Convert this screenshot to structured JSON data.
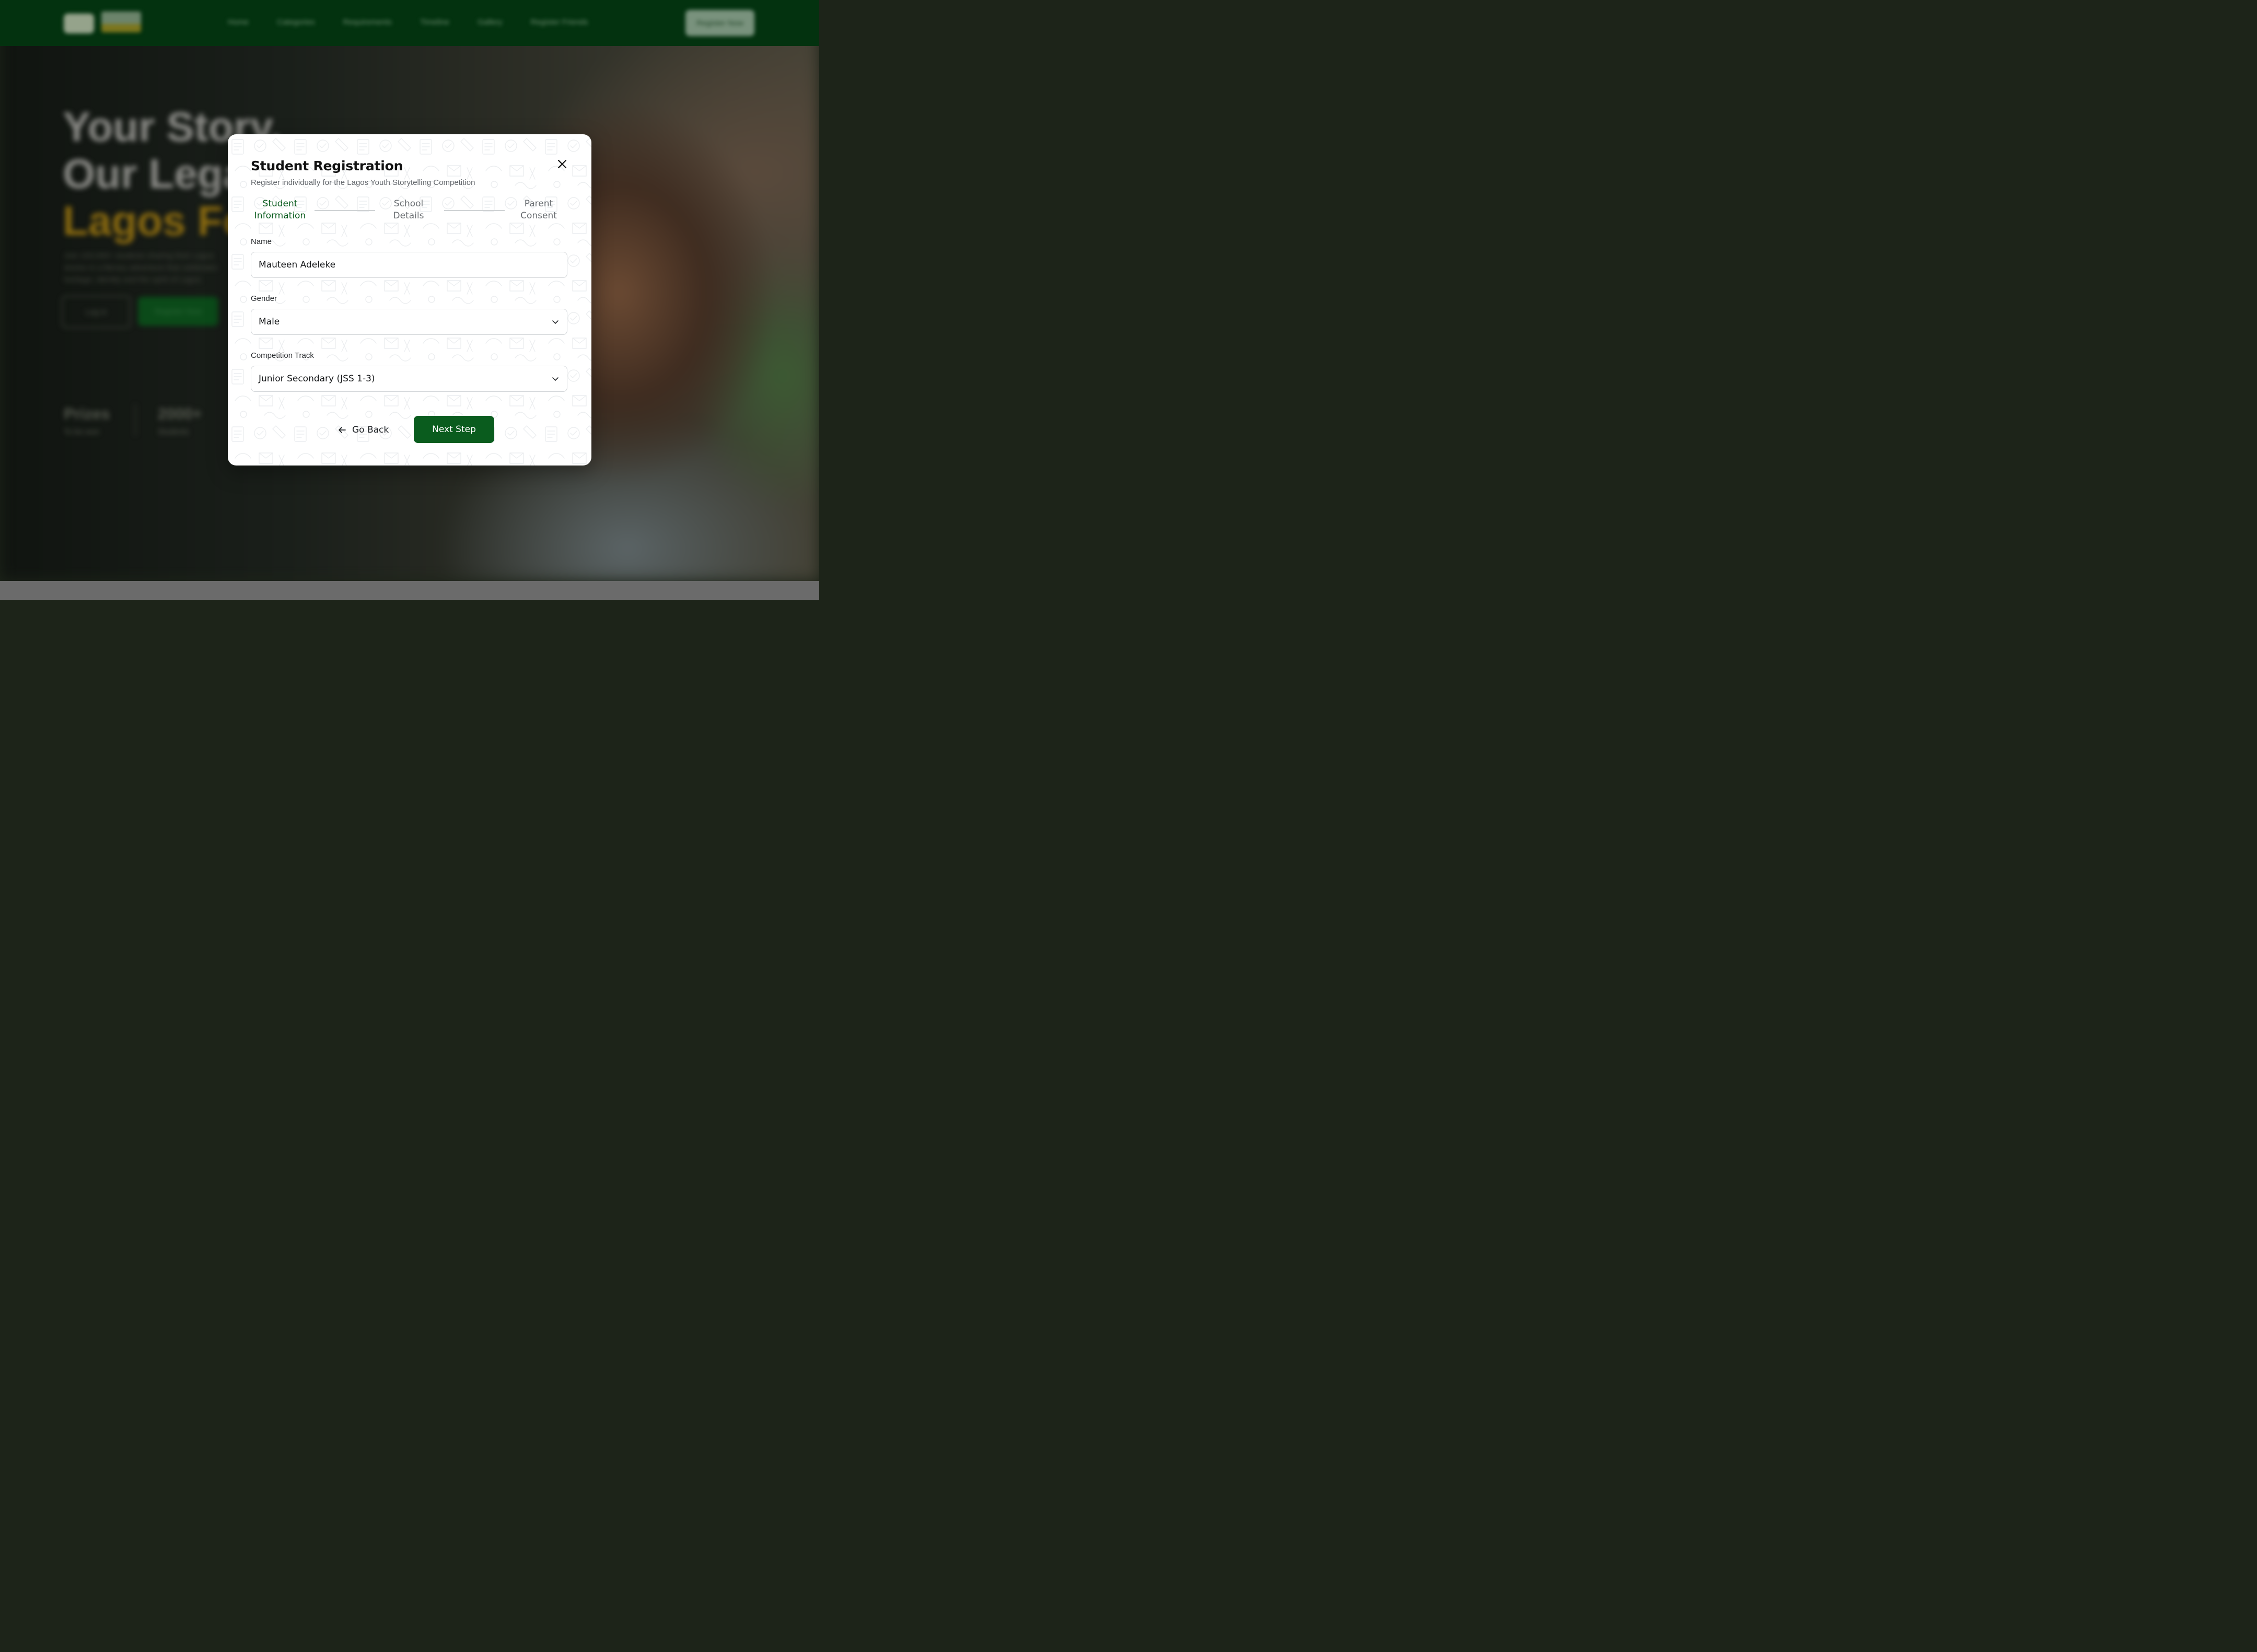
{
  "background": {
    "nav": {
      "links": [
        "Home",
        "Categories",
        "Requirements",
        "Timeline",
        "Gallery",
        "Register Friends"
      ],
      "cta_label": "Register Now"
    },
    "hero": {
      "headline_line1": "Your Story,",
      "headline_line2": "Our Legacy",
      "headline_line3": "Lagos Fo",
      "paragraph": "Join 100,000+ students sharing their Lagos stories in a literary adventure that celebrates heritage, identity and the spirit of Lagos.",
      "primary_button": "Register Now",
      "secondary_button": "Log in"
    },
    "stats": [
      {
        "value": "Prizes",
        "label": "To be won"
      },
      {
        "value": "2000+",
        "label": "Students"
      }
    ]
  },
  "modal": {
    "title": "Student Registration",
    "subtitle": "Register individually for the Lagos Youth Storytelling Competition",
    "close_icon": "close-icon",
    "steps": [
      {
        "line1": "Student",
        "line2": "Information",
        "active": true
      },
      {
        "line1": "School",
        "line2": "Details",
        "active": false
      },
      {
        "line1": "Parent",
        "line2": "Consent",
        "active": false
      }
    ],
    "fields": {
      "name": {
        "label": "Name",
        "value": "Mauteen Adeleke"
      },
      "gender": {
        "label": "Gender",
        "value": "Male"
      },
      "track": {
        "label": "Competition Track",
        "value": "Junior Secondary (JSS 1-3)"
      }
    },
    "go_back_label": "Go Back",
    "next_label": "Next Step"
  },
  "colors": {
    "brand_green": "#0a5c1e",
    "nav_green": "#03320f",
    "accent_gold": "#8a6a10"
  }
}
